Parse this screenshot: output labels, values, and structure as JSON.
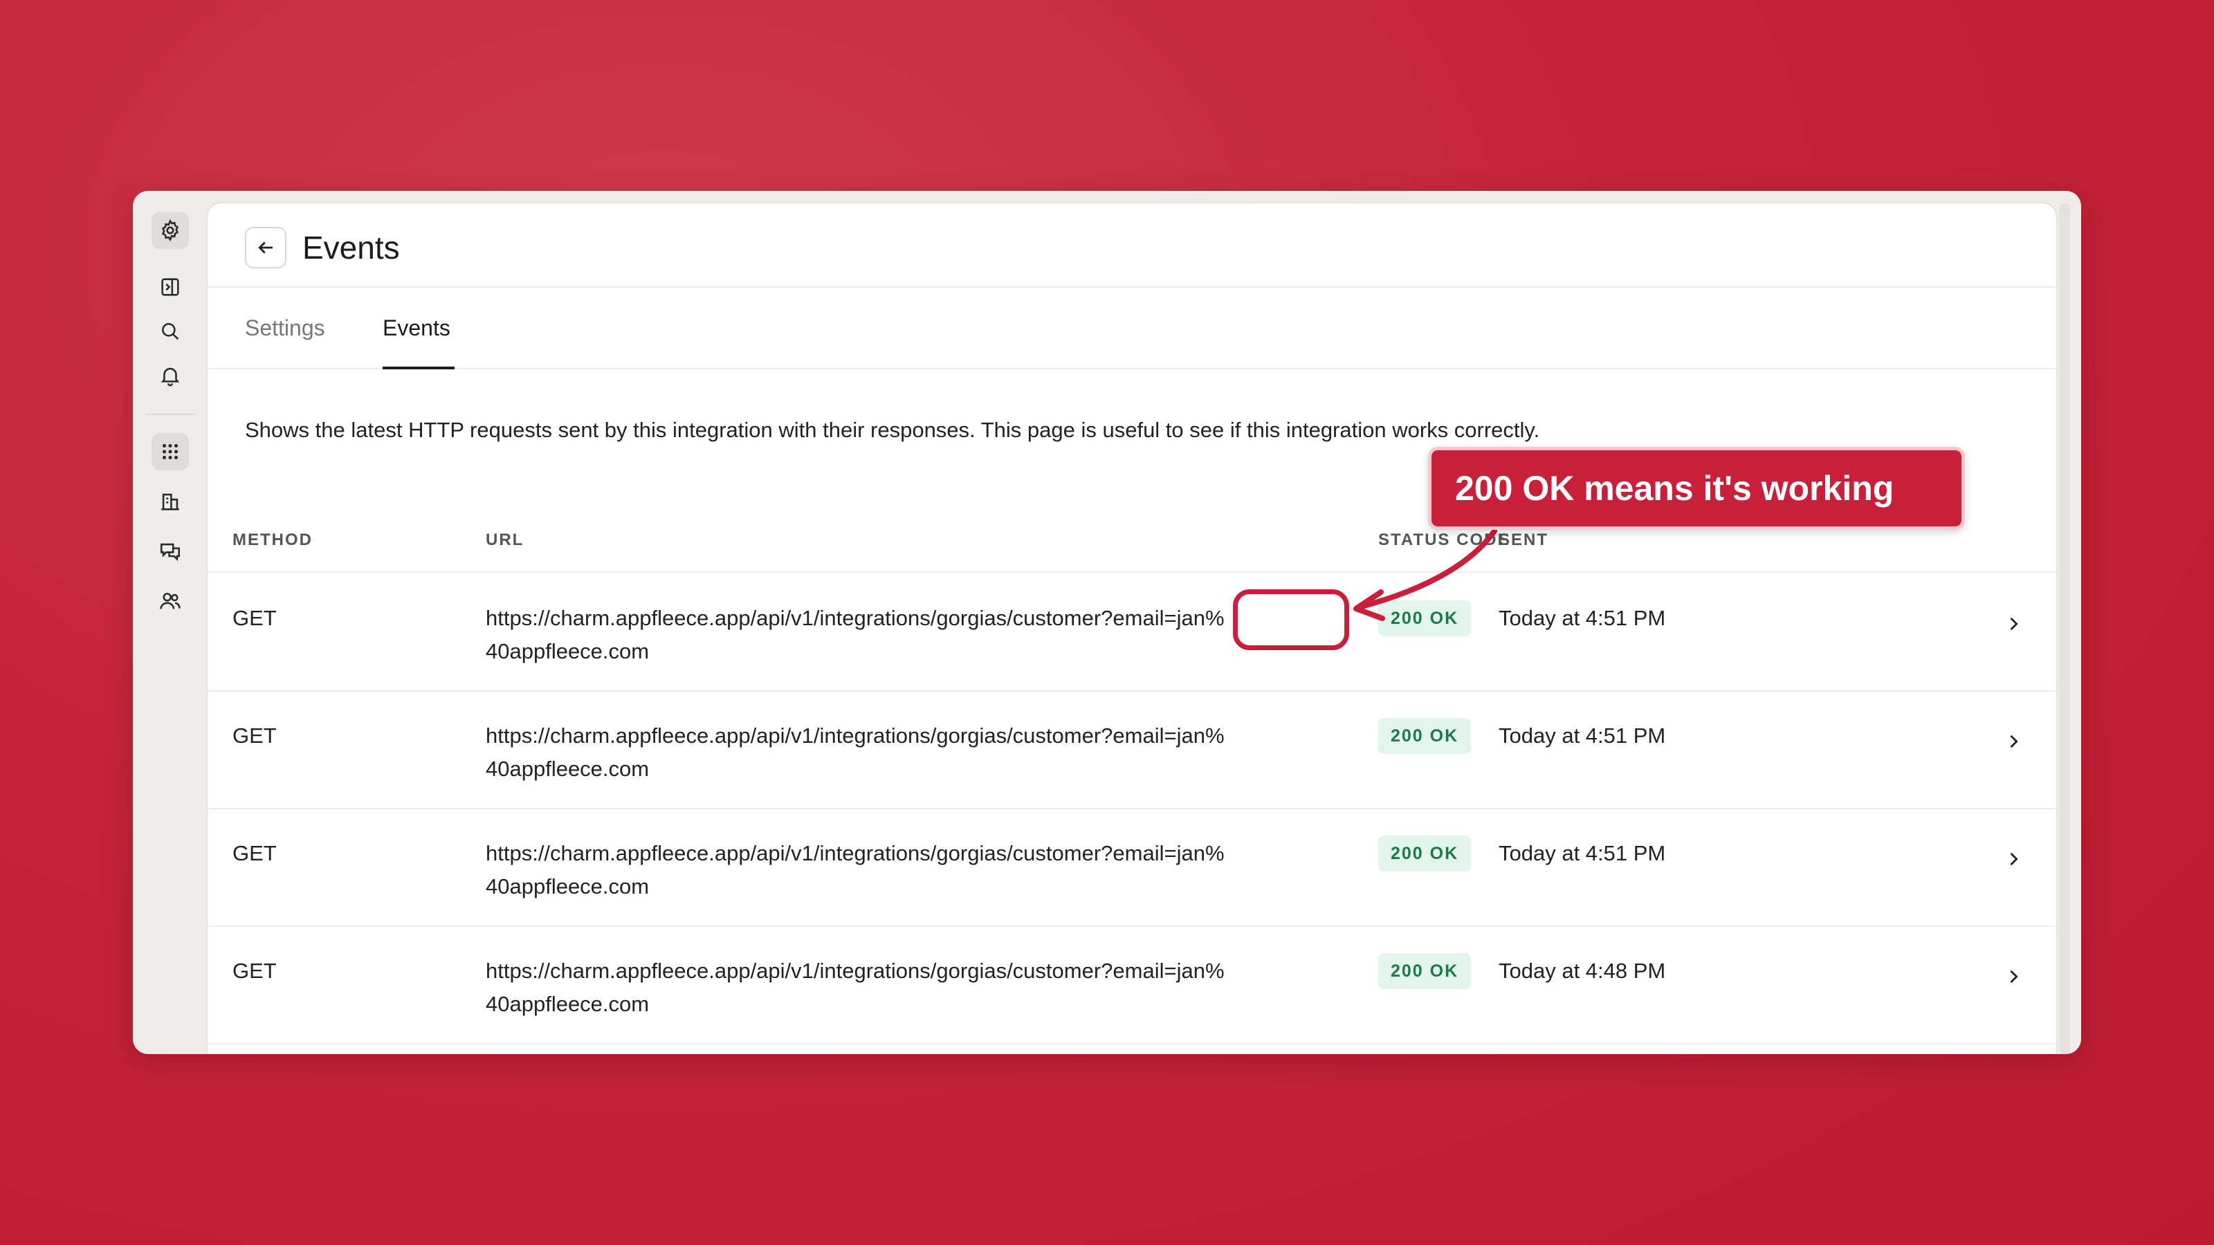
{
  "colors": {
    "background": "#c4233a",
    "accent": "#c81f3a",
    "badge_bg": "#e3f4ea",
    "badge_text": "#1b7a4a"
  },
  "rail": {
    "icons": [
      "gear-icon",
      "sidebar-toggle-icon",
      "search-icon",
      "bell-icon",
      "apps-grid-icon",
      "building-icon",
      "chat-icon",
      "users-icon"
    ]
  },
  "header": {
    "back_icon": "arrow-left-icon",
    "title": "Events"
  },
  "tabs": [
    {
      "label": "Settings",
      "active": false
    },
    {
      "label": "Events",
      "active": true
    }
  ],
  "description": "Shows the latest HTTP requests sent by this integration with their responses. This page is useful to see if this integration works correctly.",
  "table": {
    "columns": [
      "METHOD",
      "URL",
      "STATUS CODE",
      "SENT"
    ],
    "rows": [
      {
        "method": "GET",
        "url": "https://charm.appfleece.app/api/v1/integrations/gorgias/customer?email=jan%40appfleece.com",
        "status": "200 OK",
        "sent": "Today at 4:51 PM"
      },
      {
        "method": "GET",
        "url": "https://charm.appfleece.app/api/v1/integrations/gorgias/customer?email=jan%40appfleece.com",
        "status": "200 OK",
        "sent": "Today at 4:51 PM"
      },
      {
        "method": "GET",
        "url": "https://charm.appfleece.app/api/v1/integrations/gorgias/customer?email=jan%40appfleece.com",
        "status": "200 OK",
        "sent": "Today at 4:51 PM"
      },
      {
        "method": "GET",
        "url": "https://charm.appfleece.app/api/v1/integrations/gorgias/customer?email=jan%40appfleece.com",
        "status": "200 OK",
        "sent": "Today at 4:48 PM"
      }
    ]
  },
  "annotation": {
    "callout_text": "200 OK means it's working"
  }
}
